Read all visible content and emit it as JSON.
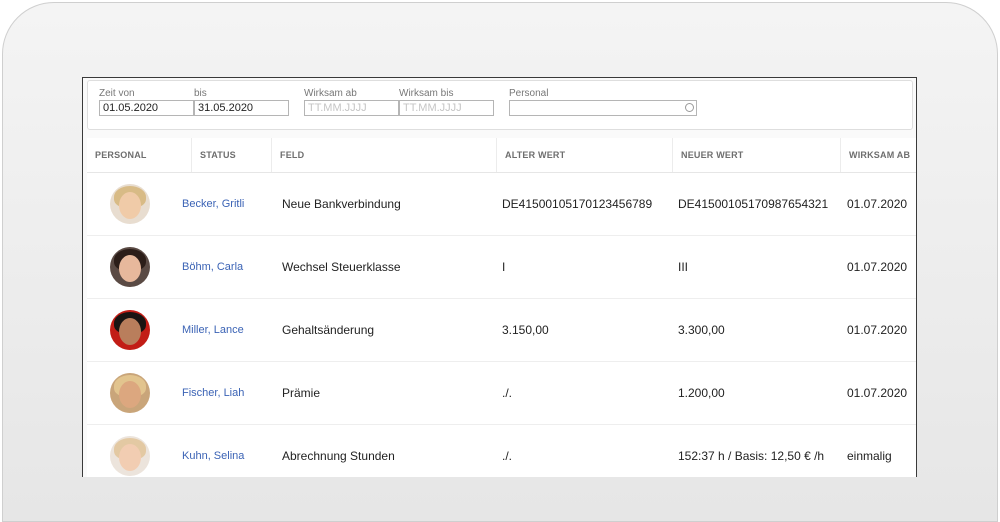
{
  "filters": {
    "zeit_von": {
      "label": "Zeit von",
      "value": "01.05.2020"
    },
    "bis": {
      "label": "bis",
      "value": "31.05.2020"
    },
    "wirksam_ab": {
      "label": "Wirksam ab",
      "placeholder": "TT.MM.JJJJ"
    },
    "wirksam_bis": {
      "label": "Wirksam bis",
      "placeholder": "TT.MM.JJJJ"
    },
    "personal": {
      "label": "Personal",
      "value": ""
    }
  },
  "table": {
    "columns": [
      "PERSONAL",
      "STATUS",
      "FELD",
      "ALTER WERT",
      "NEUER WERT",
      "WIRKSAM AB"
    ],
    "rows": [
      {
        "name": "Becker, Gritli",
        "feld": "Neue Bankverbindung",
        "alter_wert": "DE41500105170123456789",
        "neuer_wert": "DE41500105170987654321",
        "wirksam_ab": "01.07.2020"
      },
      {
        "name": "Böhm, Carla",
        "feld": "Wechsel Steuerklasse",
        "alter_wert": "I",
        "neuer_wert": "III",
        "wirksam_ab": "01.07.2020"
      },
      {
        "name": "Miller, Lance",
        "feld": "Gehaltsänderung",
        "alter_wert": "3.150,00",
        "neuer_wert": "3.300,00",
        "wirksam_ab": "01.07.2020"
      },
      {
        "name": "Fischer, Liah",
        "feld": "Prämie",
        "alter_wert": "./.",
        "neuer_wert": "1.200,00",
        "wirksam_ab": "01.07.2020"
      },
      {
        "name": "Kuhn, Selina",
        "feld": "Abrechnung Stunden",
        "alter_wert": "./.",
        "neuer_wert": "152:37 h / Basis: 12,50 € /h",
        "wirksam_ab": "einmalig"
      }
    ]
  },
  "colors": {
    "link": "#3b63b5",
    "header_text": "#6e6e6e",
    "frame": "#e9e9e9"
  }
}
